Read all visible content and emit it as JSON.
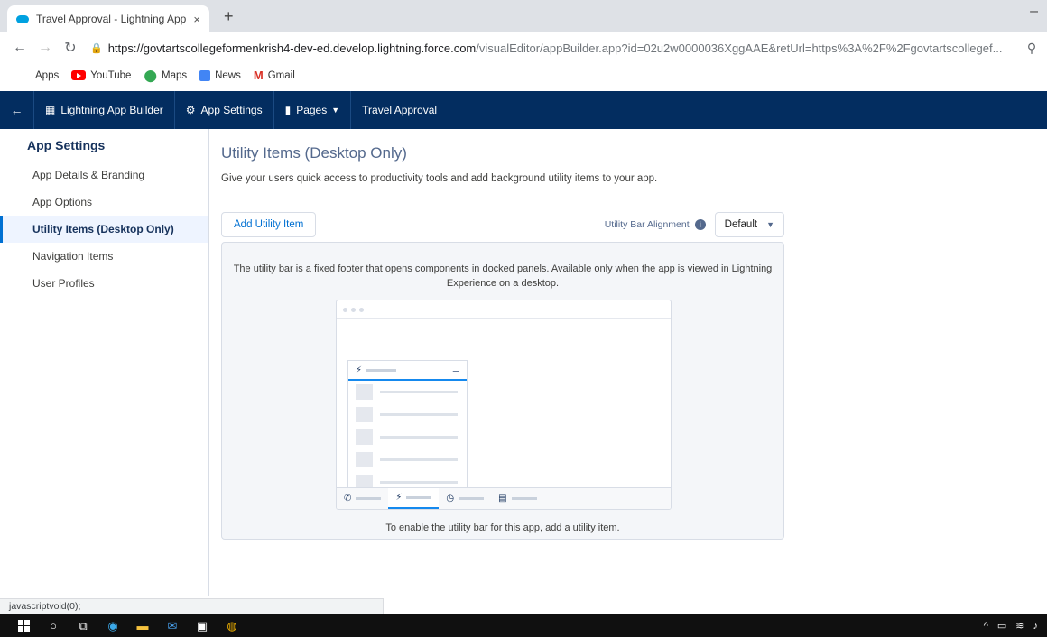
{
  "browser": {
    "tab_title": "Travel Approval - Lightning App",
    "tab_close": "×",
    "new_tab": "+",
    "minimize": "–",
    "url_host": "https://govtartscollegeformenkrish4-dev-ed.develop.lightning.force.com",
    "url_path": "/visualEditor/appBuilder.app?id=02u2w0000036XggAAE&retUrl=https%3A%2F%2Fgovtartscollegef...",
    "bookmarks": [
      {
        "label": "Apps",
        "icon": "apps-grid-icon"
      },
      {
        "label": "YouTube",
        "icon": "youtube-icon"
      },
      {
        "label": "Maps",
        "icon": "maps-pin-icon"
      },
      {
        "label": "News",
        "icon": "news-icon"
      },
      {
        "label": "Gmail",
        "icon": "gmail-icon"
      }
    ]
  },
  "header": {
    "back": "←",
    "builder": "Lightning App Builder",
    "settings": "App Settings",
    "pages": "Pages",
    "app_name": "Travel Approval"
  },
  "sidebar": {
    "title": "App Settings",
    "items": [
      {
        "label": "App Details & Branding"
      },
      {
        "label": "App Options"
      },
      {
        "label": "Utility Items (Desktop Only)",
        "active": true
      },
      {
        "label": "Navigation Items"
      },
      {
        "label": "User Profiles"
      }
    ]
  },
  "main": {
    "title": "Utility Items (Desktop Only)",
    "description": "Give your users quick access to productivity tools and add background utility items to your app.",
    "add_button": "Add Utility Item",
    "alignment_label": "Utility Bar Alignment",
    "alignment_value": "Default",
    "panel_note": "The utility bar is a fixed footer that opens components in docked panels. Available only when the app is viewed in Lightning Experience on a desktop.",
    "enable_note": "To enable the utility bar for this app, add a utility item."
  },
  "status_bar": "javascriptvoid(0);",
  "colors": {
    "header_bg": "#032d60",
    "accent": "#0070d2",
    "panel_bg": "#f4f6f9"
  }
}
